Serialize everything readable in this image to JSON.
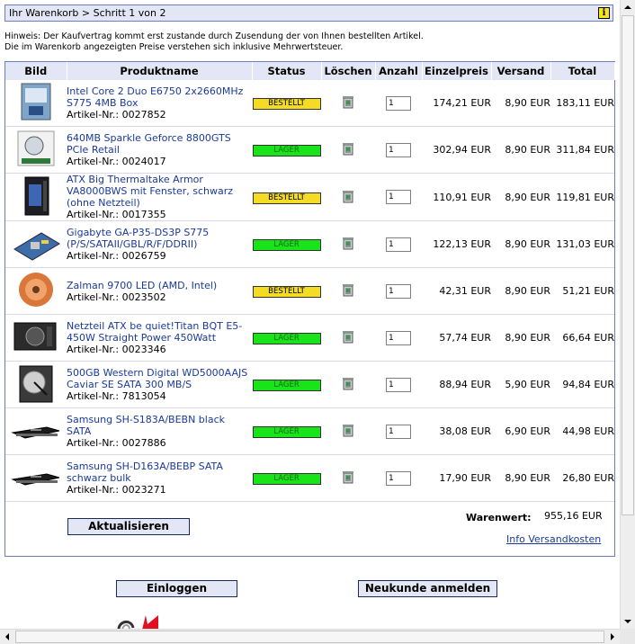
{
  "header": {
    "title": "Ihr Warenkorb > Schritt 1 von 2",
    "info_icon_label": "i"
  },
  "notice": {
    "line1": "Hinweis: Der Kaufvertrag kommt erst zustande durch Zusendung der von Ihnen bestellten Artikel.",
    "line2": "Die im Warenkorb angezeigten Preise verstehen sich inklusive Mehrwertsteuer."
  },
  "table": {
    "columns": [
      "Bild",
      "Produktname",
      "Status",
      "Löschen",
      "Anzahl",
      "Einzelpreis",
      "Versand",
      "Total"
    ],
    "rows": [
      {
        "name": "Intel Core 2 Duo E6750 2x2660MHz S775 4MB Box",
        "article": "Artikel-Nr.: 0027852",
        "status": "BESTELLT",
        "status_type": "bestellt",
        "qty": "1",
        "unit_price": "174,21 EUR",
        "shipping": "8,90 EUR",
        "total": "183,11 EUR",
        "image_icon": "cpu-box-image"
      },
      {
        "name": "640MB Sparkle Geforce 8800GTS PCIe Retail",
        "article": "Artikel-Nr.: 0024017",
        "status": "LAGER",
        "status_type": "lager",
        "qty": "1",
        "unit_price": "302,94 EUR",
        "shipping": "8,90 EUR",
        "total": "311,84 EUR",
        "image_icon": "graphics-card-image"
      },
      {
        "name": "ATX Big Thermaltake Armor VA8000BWS mit Fenster, schwarz (ohne Netzteil)",
        "article": "Artikel-Nr.: 0017355",
        "status": "BESTELLT",
        "status_type": "bestellt",
        "qty": "1",
        "unit_price": "110,91 EUR",
        "shipping": "8,90 EUR",
        "total": "119,81 EUR",
        "image_icon": "pc-case-image"
      },
      {
        "name": "Gigabyte GA-P35-DS3P S775 (P/S/SATAII/GBL/R/F/DDRII)",
        "article": "Artikel-Nr.: 0026759",
        "status": "LAGER",
        "status_type": "lager",
        "qty": "1",
        "unit_price": "122,13 EUR",
        "shipping": "8,90 EUR",
        "total": "131,03 EUR",
        "image_icon": "motherboard-image"
      },
      {
        "name": "Zalman 9700 LED (AMD, Intel)",
        "article": "Artikel-Nr.: 0023502",
        "status": "BESTELLT",
        "status_type": "bestellt",
        "qty": "1",
        "unit_price": "42,31 EUR",
        "shipping": "8,90 EUR",
        "total": "51,21 EUR",
        "image_icon": "cpu-cooler-image"
      },
      {
        "name": "Netzteil ATX be quiet!Titan BQT E5-450W Straight Power 450Watt",
        "article": "Artikel-Nr.: 0023346",
        "status": "LAGER",
        "status_type": "lager",
        "qty": "1",
        "unit_price": "57,74 EUR",
        "shipping": "8,90 EUR",
        "total": "66,64 EUR",
        "image_icon": "power-supply-image"
      },
      {
        "name": "500GB Western Digital WD5000AAJS Caviar SE SATA 300 MB/S",
        "article": "Artikel-Nr.: 7813054",
        "status": "LAGER",
        "status_type": "lager",
        "qty": "1",
        "unit_price": "88,94 EUR",
        "shipping": "5,90 EUR",
        "total": "94,84 EUR",
        "image_icon": "hard-drive-image"
      },
      {
        "name": "Samsung SH-S183A/BEBN black SATA",
        "article": "Artikel-Nr.: 0027886",
        "status": "LAGER",
        "status_type": "lager",
        "qty": "1",
        "unit_price": "38,08 EUR",
        "shipping": "6,90 EUR",
        "total": "44,98 EUR",
        "image_icon": "dvd-drive-image"
      },
      {
        "name": "Samsung SH-D163A/BEBP SATA schwarz bulk",
        "article": "Artikel-Nr.: 0023271",
        "status": "LAGER",
        "status_type": "lager",
        "qty": "1",
        "unit_price": "17,90 EUR",
        "shipping": "8,90 EUR",
        "total": "26,80 EUR",
        "image_icon": "dvd-drive-image"
      }
    ]
  },
  "summary": {
    "update_label": "Aktualisieren",
    "goods_value_label": "Warenwert:",
    "goods_value": "955,16 EUR",
    "shipping_info_link": "Info Versandkosten"
  },
  "actions": {
    "login_label": "Einloggen",
    "register_label": "Neukunde anmelden"
  },
  "colors": {
    "header_bg": "#e3e6f5",
    "border": "#6b7fb4",
    "status_bestellt": "#f4dc25",
    "status_lager": "#19e319",
    "link": "#1a3a9a"
  }
}
